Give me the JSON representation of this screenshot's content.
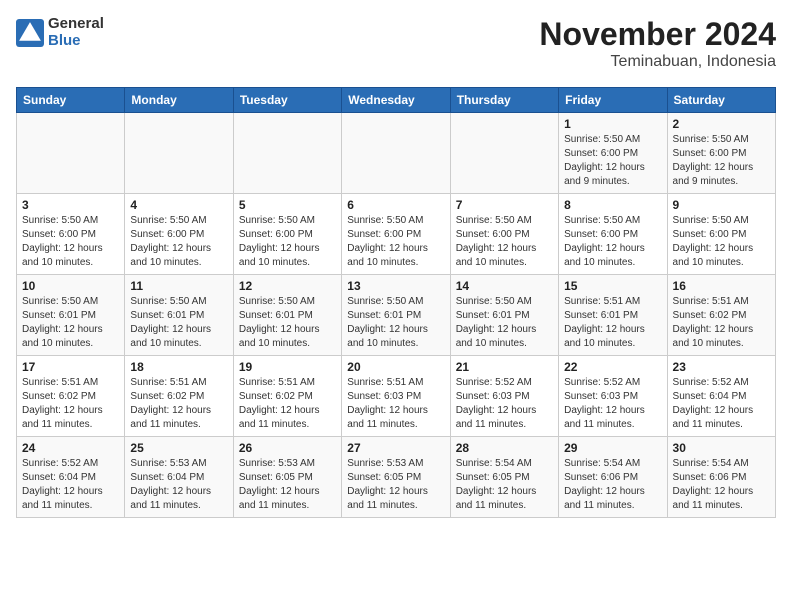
{
  "header": {
    "logo_line1": "General",
    "logo_line2": "Blue",
    "title": "November 2024",
    "subtitle": "Teminabuan, Indonesia"
  },
  "days_of_week": [
    "Sunday",
    "Monday",
    "Tuesday",
    "Wednesday",
    "Thursday",
    "Friday",
    "Saturday"
  ],
  "weeks": [
    {
      "cells": [
        {
          "day": "",
          "info": ""
        },
        {
          "day": "",
          "info": ""
        },
        {
          "day": "",
          "info": ""
        },
        {
          "day": "",
          "info": ""
        },
        {
          "day": "",
          "info": ""
        },
        {
          "day": "1",
          "info": "Sunrise: 5:50 AM\nSunset: 6:00 PM\nDaylight: 12 hours\nand 9 minutes."
        },
        {
          "day": "2",
          "info": "Sunrise: 5:50 AM\nSunset: 6:00 PM\nDaylight: 12 hours\nand 9 minutes."
        }
      ]
    },
    {
      "cells": [
        {
          "day": "3",
          "info": "Sunrise: 5:50 AM\nSunset: 6:00 PM\nDaylight: 12 hours\nand 10 minutes."
        },
        {
          "day": "4",
          "info": "Sunrise: 5:50 AM\nSunset: 6:00 PM\nDaylight: 12 hours\nand 10 minutes."
        },
        {
          "day": "5",
          "info": "Sunrise: 5:50 AM\nSunset: 6:00 PM\nDaylight: 12 hours\nand 10 minutes."
        },
        {
          "day": "6",
          "info": "Sunrise: 5:50 AM\nSunset: 6:00 PM\nDaylight: 12 hours\nand 10 minutes."
        },
        {
          "day": "7",
          "info": "Sunrise: 5:50 AM\nSunset: 6:00 PM\nDaylight: 12 hours\nand 10 minutes."
        },
        {
          "day": "8",
          "info": "Sunrise: 5:50 AM\nSunset: 6:00 PM\nDaylight: 12 hours\nand 10 minutes."
        },
        {
          "day": "9",
          "info": "Sunrise: 5:50 AM\nSunset: 6:00 PM\nDaylight: 12 hours\nand 10 minutes."
        }
      ]
    },
    {
      "cells": [
        {
          "day": "10",
          "info": "Sunrise: 5:50 AM\nSunset: 6:01 PM\nDaylight: 12 hours\nand 10 minutes."
        },
        {
          "day": "11",
          "info": "Sunrise: 5:50 AM\nSunset: 6:01 PM\nDaylight: 12 hours\nand 10 minutes."
        },
        {
          "day": "12",
          "info": "Sunrise: 5:50 AM\nSunset: 6:01 PM\nDaylight: 12 hours\nand 10 minutes."
        },
        {
          "day": "13",
          "info": "Sunrise: 5:50 AM\nSunset: 6:01 PM\nDaylight: 12 hours\nand 10 minutes."
        },
        {
          "day": "14",
          "info": "Sunrise: 5:50 AM\nSunset: 6:01 PM\nDaylight: 12 hours\nand 10 minutes."
        },
        {
          "day": "15",
          "info": "Sunrise: 5:51 AM\nSunset: 6:01 PM\nDaylight: 12 hours\nand 10 minutes."
        },
        {
          "day": "16",
          "info": "Sunrise: 5:51 AM\nSunset: 6:02 PM\nDaylight: 12 hours\nand 10 minutes."
        }
      ]
    },
    {
      "cells": [
        {
          "day": "17",
          "info": "Sunrise: 5:51 AM\nSunset: 6:02 PM\nDaylight: 12 hours\nand 11 minutes."
        },
        {
          "day": "18",
          "info": "Sunrise: 5:51 AM\nSunset: 6:02 PM\nDaylight: 12 hours\nand 11 minutes."
        },
        {
          "day": "19",
          "info": "Sunrise: 5:51 AM\nSunset: 6:02 PM\nDaylight: 12 hours\nand 11 minutes."
        },
        {
          "day": "20",
          "info": "Sunrise: 5:51 AM\nSunset: 6:03 PM\nDaylight: 12 hours\nand 11 minutes."
        },
        {
          "day": "21",
          "info": "Sunrise: 5:52 AM\nSunset: 6:03 PM\nDaylight: 12 hours\nand 11 minutes."
        },
        {
          "day": "22",
          "info": "Sunrise: 5:52 AM\nSunset: 6:03 PM\nDaylight: 12 hours\nand 11 minutes."
        },
        {
          "day": "23",
          "info": "Sunrise: 5:52 AM\nSunset: 6:04 PM\nDaylight: 12 hours\nand 11 minutes."
        }
      ]
    },
    {
      "cells": [
        {
          "day": "24",
          "info": "Sunrise: 5:52 AM\nSunset: 6:04 PM\nDaylight: 12 hours\nand 11 minutes."
        },
        {
          "day": "25",
          "info": "Sunrise: 5:53 AM\nSunset: 6:04 PM\nDaylight: 12 hours\nand 11 minutes."
        },
        {
          "day": "26",
          "info": "Sunrise: 5:53 AM\nSunset: 6:05 PM\nDaylight: 12 hours\nand 11 minutes."
        },
        {
          "day": "27",
          "info": "Sunrise: 5:53 AM\nSunset: 6:05 PM\nDaylight: 12 hours\nand 11 minutes."
        },
        {
          "day": "28",
          "info": "Sunrise: 5:54 AM\nSunset: 6:05 PM\nDaylight: 12 hours\nand 11 minutes."
        },
        {
          "day": "29",
          "info": "Sunrise: 5:54 AM\nSunset: 6:06 PM\nDaylight: 12 hours\nand 11 minutes."
        },
        {
          "day": "30",
          "info": "Sunrise: 5:54 AM\nSunset: 6:06 PM\nDaylight: 12 hours\nand 11 minutes."
        }
      ]
    }
  ]
}
